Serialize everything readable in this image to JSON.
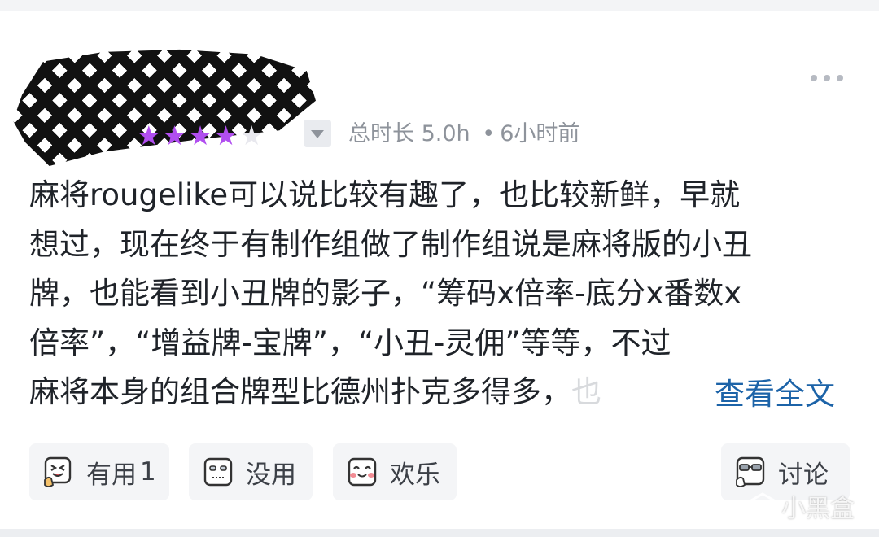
{
  "review": {
    "stars_filled": 4,
    "stars_total": 5,
    "playtime_label": "总时长",
    "playtime_value": "5.0h",
    "separator": "•",
    "time_ago": "6小时前",
    "lines": [
      "麻将rougelike可以说比较有趣了，也比较新鲜，早就",
      "想过，现在终于有制作组做了制作组说是麻将版的小丑",
      "牌，也能看到小丑牌的影子，“筹码x倍率-底分x番数x",
      "倍率”，“增益牌-宝牌”，“小丑-灵佣”等等，不过",
      "麻将本身的组合牌型比德州扑克多得多，"
    ],
    "faded_tail": "也",
    "read_more": "查看全文"
  },
  "actions": {
    "useful_label": "有用",
    "useful_count": "1",
    "useless_label": "没用",
    "fun_label": "欢乐",
    "discuss_label": "讨论"
  },
  "watermark": "小黑盒",
  "colors": {
    "star": "#b14ef0",
    "link": "#1c63a8",
    "meta": "#8e939b"
  }
}
